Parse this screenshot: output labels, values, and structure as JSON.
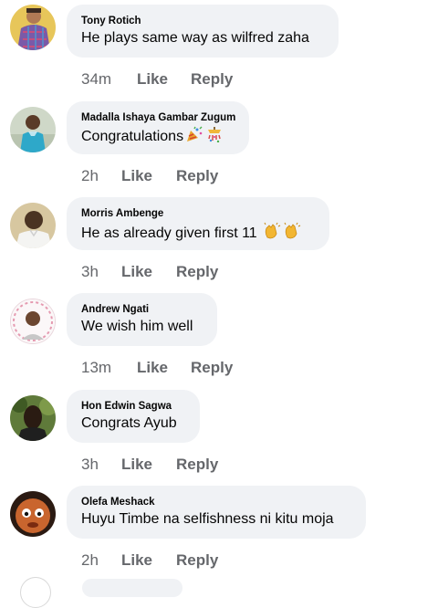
{
  "comments": [
    {
      "author": "Tony Rotich",
      "text": "He plays same way as wilfred zaha",
      "emoji": "",
      "time": "34m",
      "like_label": "Like",
      "reply_label": "Reply",
      "avatar_icon": "avatar-plaid-shirt"
    },
    {
      "author": "Madalla Ishaya Gambar Zugum",
      "text": "Congratulations",
      "emoji": "party-popper-and-confetti",
      "time": "2h",
      "like_label": "Like",
      "reply_label": "Reply",
      "avatar_icon": "avatar-blue-shirt"
    },
    {
      "author": "Morris Ambenge",
      "text": "He as already given first 11",
      "emoji": "clapping-hands-x2",
      "time": "3h",
      "like_label": "Like",
      "reply_label": "Reply",
      "avatar_icon": "avatar-white-shirt"
    },
    {
      "author": "Andrew Ngati",
      "text": "We wish him well",
      "emoji": "",
      "time": "13m",
      "like_label": "Like",
      "reply_label": "Reply",
      "avatar_icon": "avatar-pink-frame"
    },
    {
      "author": "Hon Edwin Sagwa",
      "text": "Congrats Ayub",
      "emoji": "",
      "time": "3h",
      "like_label": "Like",
      "reply_label": "Reply",
      "avatar_icon": "avatar-green-background"
    },
    {
      "author": "Olefa Meshack",
      "text": "Huyu Timbe na selfishness ni kitu moja",
      "emoji": "",
      "time": "2h",
      "like_label": "Like",
      "reply_label": "Reply",
      "avatar_icon": "avatar-cartoon-baby"
    }
  ],
  "colors": {
    "bubble": "#f0f2f5",
    "meta_text": "#65676b",
    "primary_text": "#050505"
  }
}
